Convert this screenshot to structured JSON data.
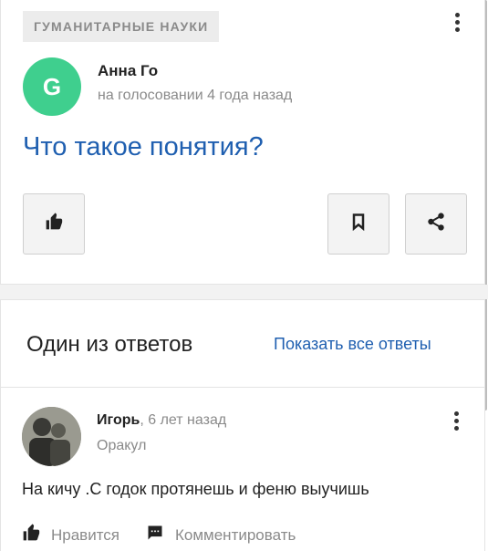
{
  "question_card": {
    "category": "Гуманитарные науки",
    "author": {
      "name": "Анна Го",
      "avatar_letter": "G",
      "avatar_color": "#3fcf8e",
      "meta": "на голосовании 4 года назад"
    },
    "question": "Что такое понятия?",
    "buttons": [
      "thumbs-up-icon",
      "bookmark-icon",
      "share-icon"
    ]
  },
  "answers_section": {
    "title": "Один из ответов",
    "show_all_label": "Показать все ответы"
  },
  "answer": {
    "author": "Игорь",
    "time": ", 6 лет назад",
    "rank": "Оракул",
    "text": "На кичу .С годок протянешь и феню выучишь",
    "actions": {
      "like_label": "Нравится",
      "comment_label": "Комментировать"
    }
  },
  "colors": {
    "link": "#1f5fb0",
    "muted": "#8a8a8a",
    "avatar": "#3fcf8e"
  }
}
